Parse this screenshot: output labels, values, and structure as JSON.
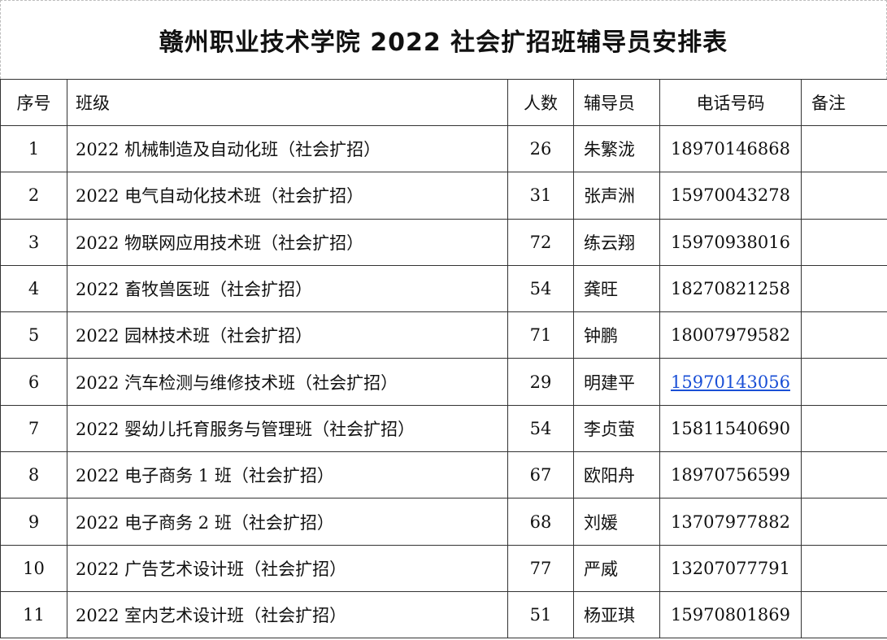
{
  "title": "赣州职业技术学院 2022 社会扩招班辅导员安排表",
  "headers": {
    "no": "序号",
    "class": "班级",
    "count": "人数",
    "tutor": "辅导员",
    "phone": "电话号码",
    "note": "备注"
  },
  "rows": [
    {
      "no": "1",
      "class": "2022 机械制造及自动化班（社会扩招）",
      "count": "26",
      "tutor": "朱繁泷",
      "phone": "18970146868",
      "note": ""
    },
    {
      "no": "2",
      "class": "2022 电气自动化技术班（社会扩招）",
      "count": "31",
      "tutor": "张声洲",
      "phone": "15970043278",
      "note": ""
    },
    {
      "no": "3",
      "class": "2022 物联网应用技术班（社会扩招）",
      "count": "72",
      "tutor": "练云翔",
      "phone": "15970938016",
      "note": ""
    },
    {
      "no": "4",
      "class": "2022 畜牧兽医班（社会扩招）",
      "count": "54",
      "tutor": "龚旺",
      "phone": "18270821258",
      "note": ""
    },
    {
      "no": "5",
      "class": "2022 园林技术班（社会扩招）",
      "count": "71",
      "tutor": "钟鹏",
      "phone": "18007979582",
      "note": ""
    },
    {
      "no": "6",
      "class": "2022 汽车检测与维修技术班（社会扩招）",
      "count": "29",
      "tutor": "明建平",
      "phone": "15970143056",
      "note": ""
    },
    {
      "no": "7",
      "class": "2022 婴幼儿托育服务与管理班（社会扩招）",
      "count": "54",
      "tutor": "李贞萤",
      "phone": "15811540690",
      "note": ""
    },
    {
      "no": "8",
      "class": "2022 电子商务 1 班（社会扩招）",
      "count": "67",
      "tutor": "欧阳舟",
      "phone": "18970756599",
      "note": ""
    },
    {
      "no": "9",
      "class": "2022 电子商务 2 班（社会扩招）",
      "count": "68",
      "tutor": "刘媛",
      "phone": "13707977882",
      "note": ""
    },
    {
      "no": "10",
      "class": "2022 广告艺术设计班（社会扩招）",
      "count": "77",
      "tutor": "严威",
      "phone": "13207077791",
      "note": ""
    },
    {
      "no": "11",
      "class": "2022 室内艺术设计班（社会扩招）",
      "count": "51",
      "tutor": "杨亚琪",
      "phone": "15970801869",
      "note": ""
    }
  ],
  "colors": {
    "link": "#1a4fd6",
    "border": "#333333"
  }
}
